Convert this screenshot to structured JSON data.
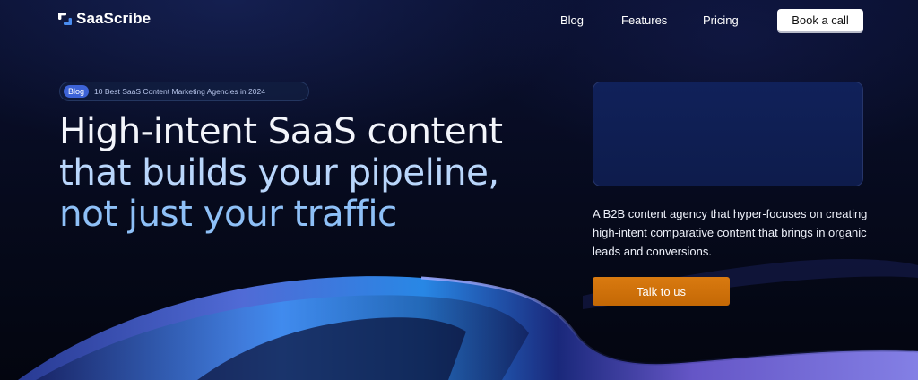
{
  "brand": {
    "name": "SaaScribe",
    "logo_icon": "s-logo-icon"
  },
  "nav": {
    "items": [
      {
        "label": "Blog"
      },
      {
        "label": "Features"
      },
      {
        "label": "Pricing"
      }
    ],
    "cta_label": "Book a call"
  },
  "badge": {
    "tag": "Blog",
    "text": "10 Best SaaS Content Marketing Agencies in 2024"
  },
  "hero": {
    "headline_lines": [
      "High-intent SaaS content",
      "that builds your pipeline,",
      "not just your traffic"
    ],
    "description": "A B2B content agency that hyper-focuses on creating high-intent comparative content that brings in organic leads and conversions.",
    "cta_label": "Talk to us"
  },
  "colors": {
    "background": "#060a1c",
    "accent_orange": "#d97a10",
    "headline_light": "#f3f5fb",
    "headline_blue": "#8ec0f7",
    "badge_blue": "#3d63d6"
  }
}
